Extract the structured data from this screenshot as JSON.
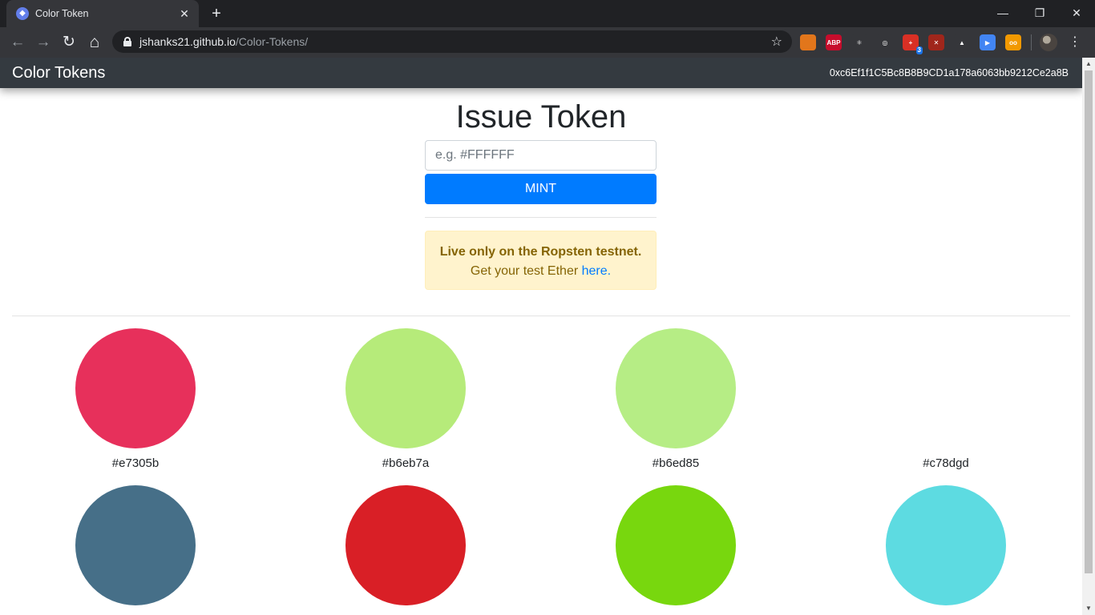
{
  "browser": {
    "tab_title": "Color Token",
    "tab_close": "✕",
    "new_tab": "+",
    "url_host": "jshanks21.github.io",
    "url_path": "/Color-Tokens/",
    "window_controls": {
      "minimize": "—",
      "restore": "❐",
      "close": "✕"
    },
    "nav": {
      "back": "←",
      "forward": "→",
      "reload": "↻",
      "home": "⌂"
    },
    "extensions": [
      {
        "icon": "metamask-fox-icon",
        "color": "#e2761b",
        "text": ""
      },
      {
        "icon": "adblock-plus-icon",
        "color": "#c70d2c",
        "text": "ABP"
      },
      {
        "icon": "react-devtools-icon",
        "color": "#35363a",
        "text": "⚛"
      },
      {
        "icon": "target-icon",
        "color": "#35363a",
        "text": "◎"
      },
      {
        "icon": "badge-extension-icon",
        "color": "#d93025",
        "text": "+"
      },
      {
        "icon": "red-circle-extension-icon",
        "color": "#a0261b",
        "text": "✕"
      },
      {
        "icon": "bar-chart-extension-icon",
        "color": "#35363a",
        "text": "▲"
      },
      {
        "icon": "blue-square-extension-icon",
        "color": "#4285f4",
        "text": "▶"
      },
      {
        "icon": "owl-extension-icon",
        "color": "#f29900",
        "text": "oo"
      }
    ],
    "extension_badge": "3",
    "star": "☆",
    "menu": "⋮"
  },
  "navbar": {
    "brand": "Color Tokens",
    "account": "0xc6Ef1f1C5Bc8B8B9CD1a178a6063bb9212Ce2a8B"
  },
  "issue": {
    "title": "Issue Token",
    "input_placeholder": "e.g. #FFFFFF",
    "mint_label": "MINT"
  },
  "alert": {
    "strong": "Live only on the Ropsten testnet.",
    "text": "Get your test Ether ",
    "link": "here."
  },
  "tokens": [
    {
      "label": "#e7305b",
      "color": "#e7305b"
    },
    {
      "label": "#b6eb7a",
      "color": "#b6eb7a"
    },
    {
      "label": "#b6ed85",
      "color": "#b6ed85"
    },
    {
      "label": "#c78dgd",
      "color": ""
    },
    {
      "label": "",
      "color": "#466f88"
    },
    {
      "label": "",
      "color": "#d91f26"
    },
    {
      "label": "",
      "color": "#78d70e"
    },
    {
      "label": "",
      "color": "#5ddbe1"
    }
  ],
  "colors": {
    "navbar_bg": "#343a40",
    "primary": "#007bff",
    "alert_bg": "#fff3cd",
    "alert_text": "#856404"
  }
}
